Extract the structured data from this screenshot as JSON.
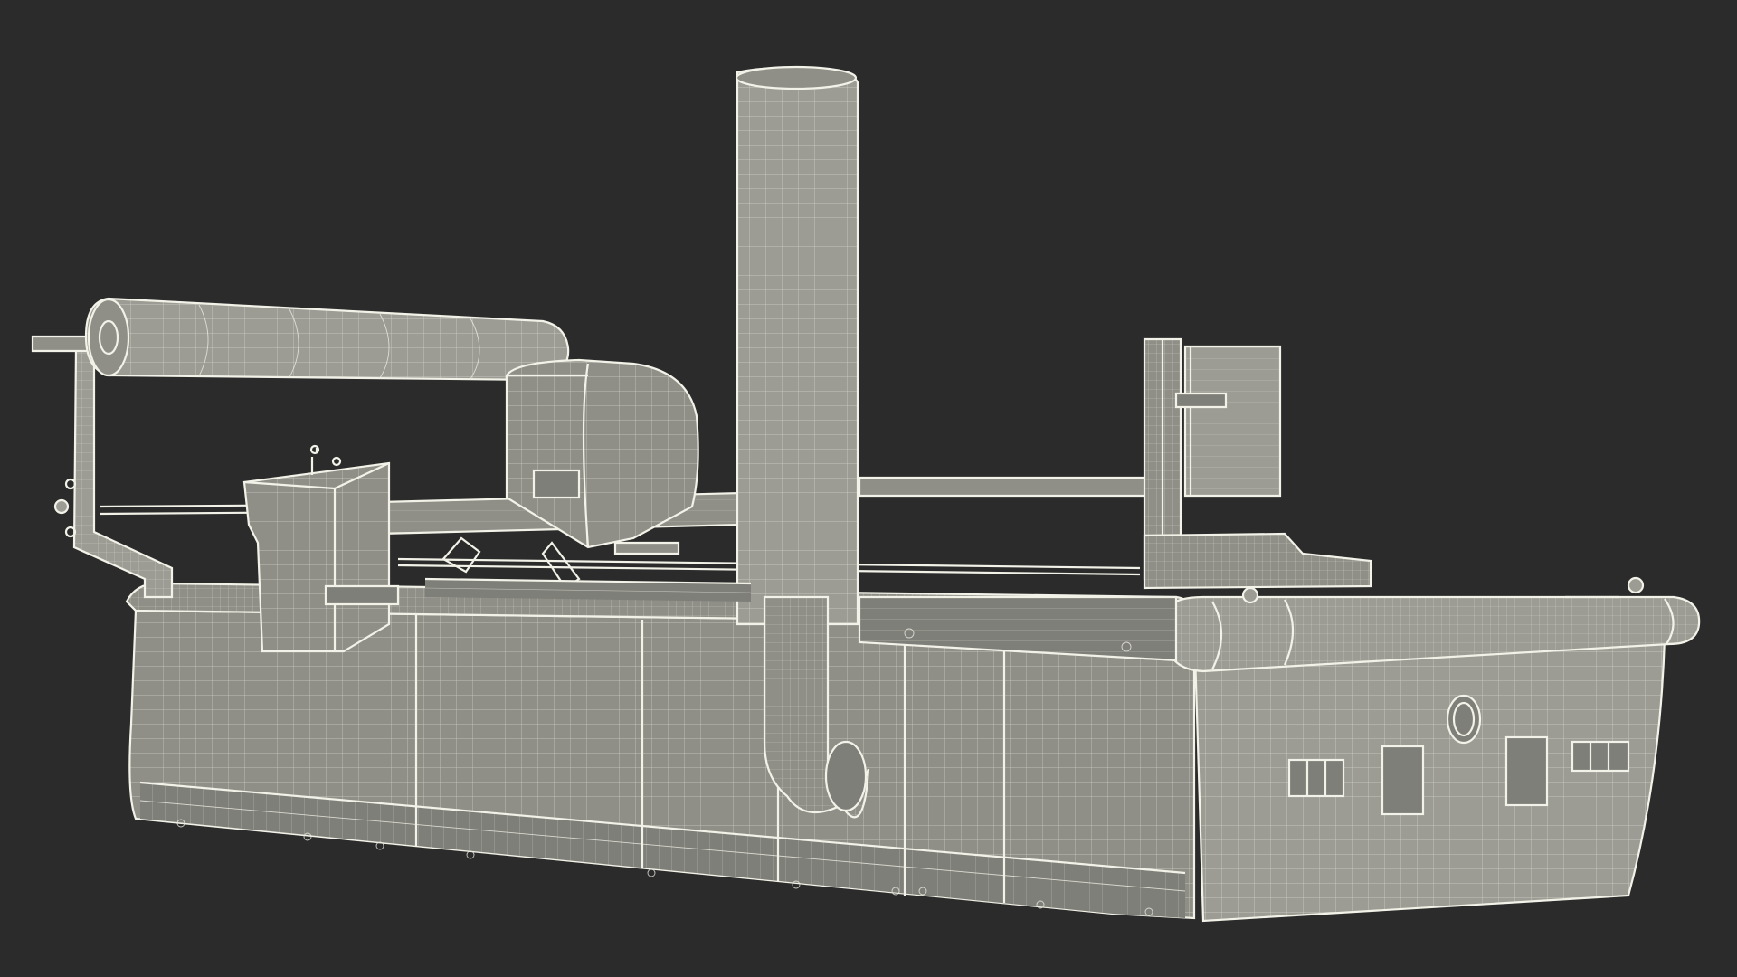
{
  "scene": {
    "subject": "wireframe-machine-render",
    "background_color": "#2b2b2b",
    "mesh_fill_color": "#8f8f88",
    "wire_color": "#f2f2e8"
  }
}
